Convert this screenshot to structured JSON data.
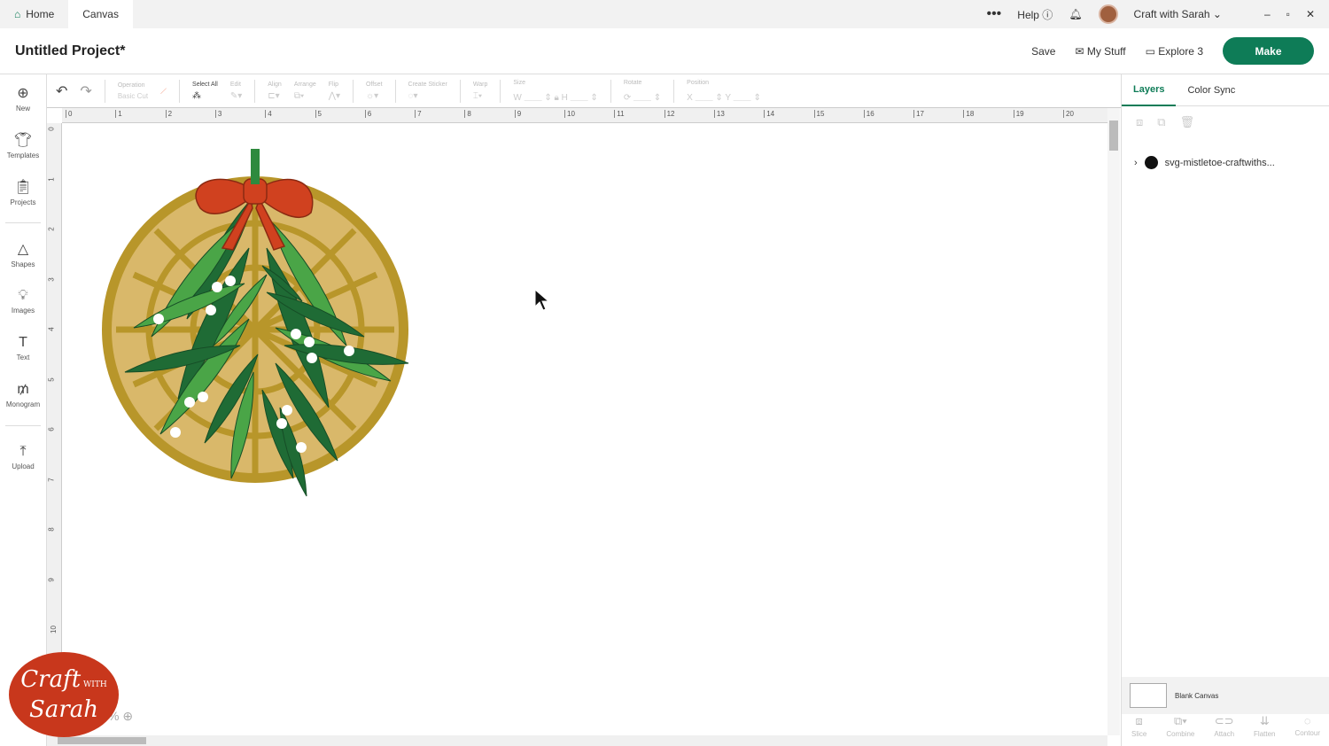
{
  "tabs": [
    {
      "label": "Home"
    },
    {
      "label": "Canvas"
    }
  ],
  "top": {
    "help": "Help",
    "user": "Craft with Sarah"
  },
  "header": {
    "title": "Untitled Project*",
    "save": "Save",
    "my_stuff": "My Stuff",
    "machine": "Explore 3",
    "make": "Make"
  },
  "left_nav": [
    {
      "label": "New",
      "icon": "plus-circle"
    },
    {
      "label": "Templates",
      "icon": "shirt"
    },
    {
      "label": "Projects",
      "icon": "clipboard"
    },
    {
      "label": "Shapes",
      "icon": "shapes"
    },
    {
      "label": "Images",
      "icon": "bulb"
    },
    {
      "label": "Text",
      "icon": "T"
    },
    {
      "label": "Monogram",
      "icon": "monogram"
    },
    {
      "label": "Upload",
      "icon": "upload"
    }
  ],
  "toolbar": {
    "operation": "Operation",
    "operation_value": "Basic Cut",
    "select_all": "Select All",
    "edit": "Edit",
    "align": "Align",
    "arrange": "Arrange",
    "flip": "Flip",
    "offset": "Offset",
    "create_sticker": "Create Sticker",
    "warp": "Warp",
    "size": "Size",
    "w": "W",
    "h": "H",
    "rotate": "Rotate",
    "position": "Position",
    "x": "X",
    "y": "Y"
  },
  "ruler_x": [
    "0",
    "1",
    "2",
    "3",
    "4",
    "5",
    "6",
    "7",
    "8",
    "9",
    "10",
    "11",
    "12",
    "13",
    "14",
    "15",
    "16",
    "17",
    "18",
    "19",
    "20"
  ],
  "ruler_y": [
    "0",
    "1",
    "2",
    "3",
    "4",
    "5",
    "6",
    "7",
    "8",
    "9",
    "10"
  ],
  "right": {
    "tabs": [
      "Layers",
      "Color Sync"
    ],
    "layer_name": "svg-mistletoe-craftwiths...",
    "blank_canvas": "Blank Canvas",
    "actions": [
      "Slice",
      "Combine",
      "Attach",
      "Flatten",
      "Contour"
    ]
  },
  "zoom": "%",
  "logo": {
    "line1": "Craft",
    "with": "WITH",
    "line2": "Sarah"
  },
  "colors": {
    "accent": "#0e7c57",
    "gold": "#b8962a",
    "leaf_dark": "#1f6b35",
    "leaf_light": "#4aa547",
    "bow": "#d0411f"
  }
}
